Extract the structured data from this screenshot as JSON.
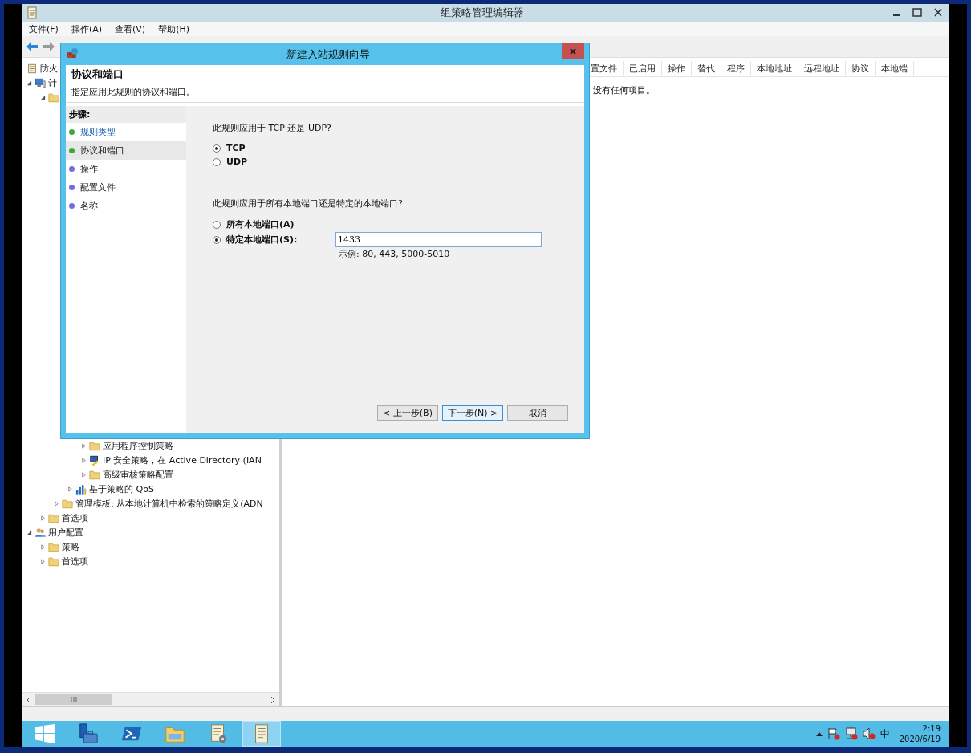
{
  "window": {
    "title": "组策略管理编辑器"
  },
  "menu": [
    "文件(F)",
    "操作(A)",
    "查看(V)",
    "帮助(H)"
  ],
  "tree": [
    {
      "label": "防火",
      "kind": "document"
    },
    {
      "label": "计",
      "kind": "computer",
      "expanded": true,
      "children": [
        {
          "kind": "folder",
          "expanded": true,
          "children": [
            {
              "children": [
                {
                  "children": [
                    {
                      "label": "应用程序控制策略",
                      "kind": "folder",
                      "expanded": false
                    },
                    {
                      "label": "IP 安全策略，在 Active Directory (IAN",
                      "kind": "shield",
                      "expanded": false
                    },
                    {
                      "label": "高级审核策略配置",
                      "kind": "folder",
                      "expanded": false
                    }
                  ]
                },
                {
                  "label": "基于策略的 QoS",
                  "kind": "chart",
                  "expanded": false
                }
              ]
            },
            {
              "label": "管理模板: 从本地计算机中检索的策略定义(ADN",
              "kind": "folder",
              "expanded": false
            }
          ]
        },
        {
          "label": "首选项",
          "kind": "folder",
          "expanded": false
        }
      ]
    },
    {
      "label": "用户配置",
      "kind": "user",
      "expanded": true,
      "children": [
        {
          "label": "策略",
          "kind": "folder",
          "expanded": false
        },
        {
          "label": "首选项",
          "kind": "folder",
          "expanded": false
        }
      ]
    }
  ],
  "list": {
    "columns": [
      "置文件",
      "已启用",
      "操作",
      "替代",
      "程序",
      "本地地址",
      "远程地址",
      "协议",
      "本地端"
    ],
    "empty_message": "没有任何项目。"
  },
  "dialog": {
    "title": "新建入站规则向导",
    "heading": "协议和端口",
    "subtitle": "指定应用此规则的协议和端口。",
    "steps_label": "步骤:",
    "steps": [
      {
        "label": "规则类型",
        "completed": true,
        "selected": false,
        "color": "#3da83d"
      },
      {
        "label": "协议和端口",
        "completed": false,
        "selected": true,
        "color": "#3da83d"
      },
      {
        "label": "操作",
        "completed": false,
        "selected": false,
        "color": "#6f6fd6"
      },
      {
        "label": "配置文件",
        "completed": false,
        "selected": false,
        "color": "#6f6fd6"
      },
      {
        "label": "名称",
        "completed": false,
        "selected": false,
        "color": "#6f6fd6"
      }
    ],
    "protocol_question": "此规则应用于 TCP 还是 UDP?",
    "protocols": [
      {
        "label": "TCP",
        "selected": true
      },
      {
        "label": "UDP",
        "selected": false
      }
    ],
    "port_question": "此规则应用于所有本地端口还是特定的本地端口?",
    "port_options": [
      {
        "label": "所有本地端口(A)",
        "selected": false
      },
      {
        "label": "特定本地端口(S):",
        "selected": true
      }
    ],
    "port_field": {
      "value": "1433"
    },
    "example": "示例: 80, 443, 5000-5010",
    "buttons": [
      {
        "label": "< 上一步(B)",
        "focused": false
      },
      {
        "label": "下一步(N) >",
        "focused": true
      },
      {
        "label": "取消",
        "focused": false
      }
    ]
  },
  "taskbar": {
    "apps": [
      {
        "kind": "server-manager",
        "active": false
      },
      {
        "kind": "powershell",
        "active": false
      },
      {
        "kind": "folder",
        "active": false
      },
      {
        "kind": "policy",
        "active": false
      },
      {
        "kind": "notepad",
        "active": true
      }
    ],
    "ime": "中",
    "time": "2:19",
    "date": "2020/6/19"
  }
}
